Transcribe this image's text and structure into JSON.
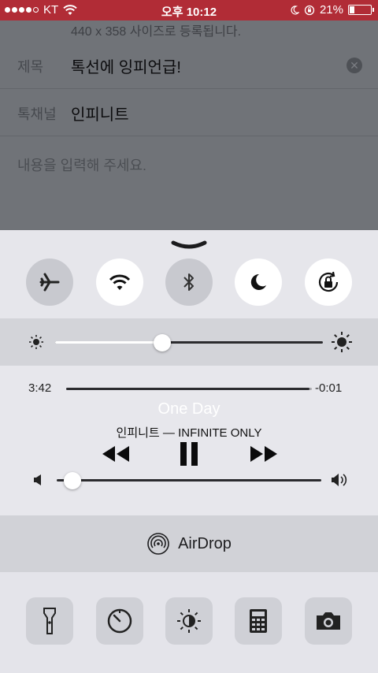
{
  "status_bar": {
    "carrier": "KT",
    "time": "오후 10:12",
    "battery_percent": "21%",
    "battery_level": 0.21,
    "icons": [
      "signal-dots-icon",
      "wifi-icon",
      "moon-icon",
      "rotation-lock-icon",
      "battery-icon"
    ]
  },
  "form": {
    "hint_text": "440 x 358 사이즈로 등록됩니다.",
    "title_label": "제목",
    "title_value": "톡선에 잉피언급!",
    "channel_label": "톡채널",
    "channel_value": "인피니트",
    "content_placeholder": "내용을 입력해 주세요."
  },
  "control_center": {
    "toggles": [
      {
        "name": "airplane-mode",
        "icon": "airplane-icon",
        "on": false
      },
      {
        "name": "wifi",
        "icon": "wifi-icon",
        "on": true
      },
      {
        "name": "bluetooth",
        "icon": "bluetooth-icon",
        "on": false
      },
      {
        "name": "do-not-disturb",
        "icon": "moon-icon",
        "on": true
      },
      {
        "name": "rotation-lock",
        "icon": "rotation-lock-icon",
        "on": true
      }
    ],
    "brightness_level": 0.4,
    "music": {
      "elapsed": "3:42",
      "remaining": "-0:01",
      "progress": 0.99,
      "song_title": "One Day",
      "artist_album": "인피니트 — INFINITE ONLY",
      "volume_level": 0.03
    },
    "airdrop_label": "AirDrop",
    "tools": [
      {
        "name": "flashlight",
        "icon": "flashlight-icon"
      },
      {
        "name": "timer",
        "icon": "timer-icon"
      },
      {
        "name": "night-shift",
        "icon": "night-shift-icon"
      },
      {
        "name": "calculator",
        "icon": "calculator-icon"
      },
      {
        "name": "camera",
        "icon": "camera-icon"
      }
    ]
  },
  "colors": {
    "status_bar": "#b12c36",
    "panel": "#e6e6eb",
    "toggle_off": "#c8c9cf",
    "toggle_on": "#ffffff"
  }
}
